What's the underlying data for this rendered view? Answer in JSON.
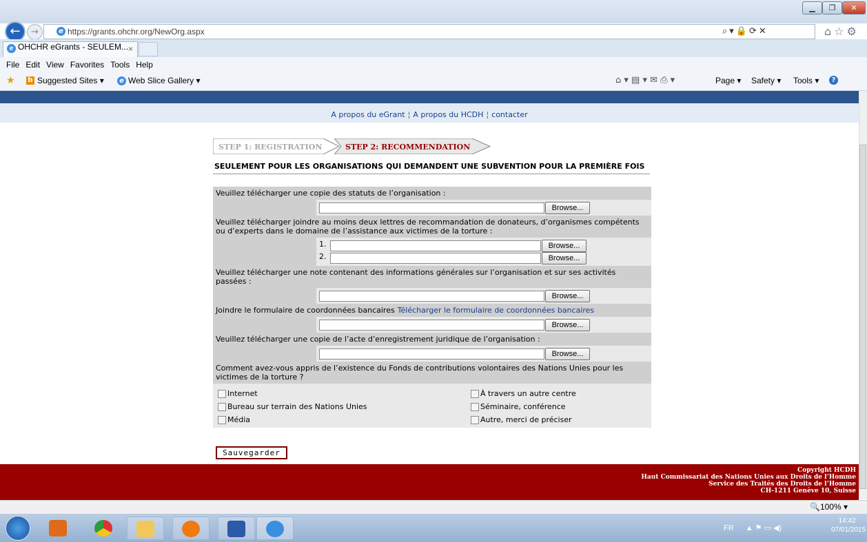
{
  "browser": {
    "address": "https://grants.ohchr.org/NewOrg.aspx",
    "tab_title": "OHCHR eGrants - SEULEM...",
    "tab_close": "×",
    "menu": [
      "File",
      "Edit",
      "View",
      "Favorites",
      "Tools",
      "Help"
    ],
    "favorites": [
      "Suggested Sites ▾",
      "Web Slice Gallery ▾"
    ],
    "commands": [
      "Page ▾",
      "Safety ▾",
      "Tools ▾"
    ],
    "zoom": "100%"
  },
  "topnav": {
    "links": [
      "A propos du eGrant",
      "A propos du HCDH",
      "contacter"
    ],
    "separator": "¦"
  },
  "steps": {
    "step1": "STEP 1: REGISTRATION",
    "step2": "STEP 2: RECOMMENDATION"
  },
  "heading": "SEULEMENT POUR LES ORGANISATIONS QUI DEMANDENT UNE SUBVENTION POUR LA PREMIÈRE FOIS",
  "form": {
    "q1": "Veuillez télécharger une copie des statuts de l’organisation :",
    "q2": "Veuillez télécharger joindre au moins deux lettres de recommandation de donateurs, d’organismes compétents ou d’experts dans le domaine de l’assistance aux victimes de la torture :",
    "q3": "Veuillez télécharger une note contenant des informations générales sur l’organisation et sur ses activités passées :",
    "q4": "Joindre le formulaire de coordonnées bancaires",
    "q4_link": "Télécharger le formulaire de coordonnées bancaires",
    "q5": "Veuillez télécharger une copie de l’acte d’enregistrement juridique de l’organisation :",
    "q6": "Comment avez-vous appris de l’existence du Fonds de contributions volontaires des Nations Unies pour les victimes de la torture ?",
    "browse": "Browse...",
    "num1": "1.",
    "num2": "2.",
    "options_left": [
      "Internet",
      "Bureau sur terrain des Nations Unies",
      "Média"
    ],
    "options_right": [
      "À travers un autre centre",
      "Séminaire, conférence",
      "Autre, merci de préciser"
    ],
    "save": "Sauvegarder"
  },
  "footer": {
    "line1": "Copyright HCDH",
    "line2": "Haut Commissariat des Nations Unies aux Droits de l’Homme",
    "line3": "Service des Traités des Droits de l’Homme",
    "line4": "CH-1211 Genève 10, Suisse"
  },
  "taskbar": {
    "lang": "FR",
    "time": "14:42",
    "date": "07/01/2015"
  },
  "colors": {
    "footer": "#990000",
    "nav_band": "#2d548d",
    "step_active_text": "#990000",
    "link": "#1a3f87"
  }
}
